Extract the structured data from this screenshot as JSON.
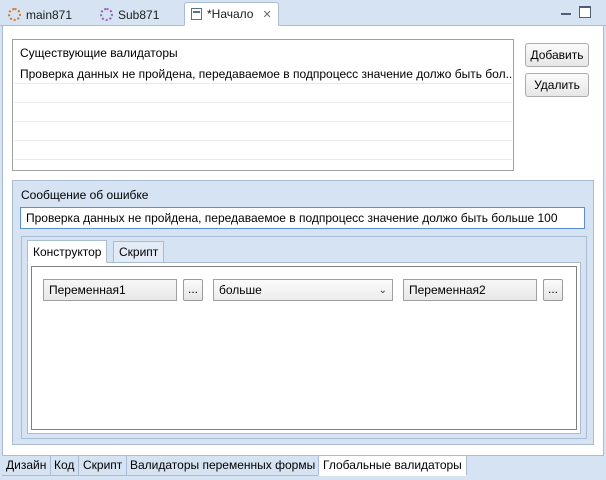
{
  "editor_tabs": [
    {
      "label": "main871"
    },
    {
      "label": "Sub871"
    },
    {
      "label": "*Начало"
    }
  ],
  "validators": {
    "title": "Существующие валидаторы",
    "rows": [
      "Проверка данных не пройдена, передаваемое в подпроцесс значение должо быть бол..."
    ],
    "add_label": "Добавить",
    "delete_label": "Удалить"
  },
  "error": {
    "title": "Сообщение об ошибке",
    "value": "Проверка данных не пройдена, передаваемое в подпроцесс значение должо быть больше 100"
  },
  "inner_tabs": {
    "constructor": "Конструктор",
    "script": "Скрипт"
  },
  "constructor": {
    "var1": "Переменная1",
    "operator": "больше",
    "var2": "Переменная2",
    "dots": "..."
  },
  "bottom_tabs": [
    "Дизайн",
    "Код",
    "Скрипт",
    "Валидаторы переменных формы",
    "Глобальные валидаторы"
  ]
}
